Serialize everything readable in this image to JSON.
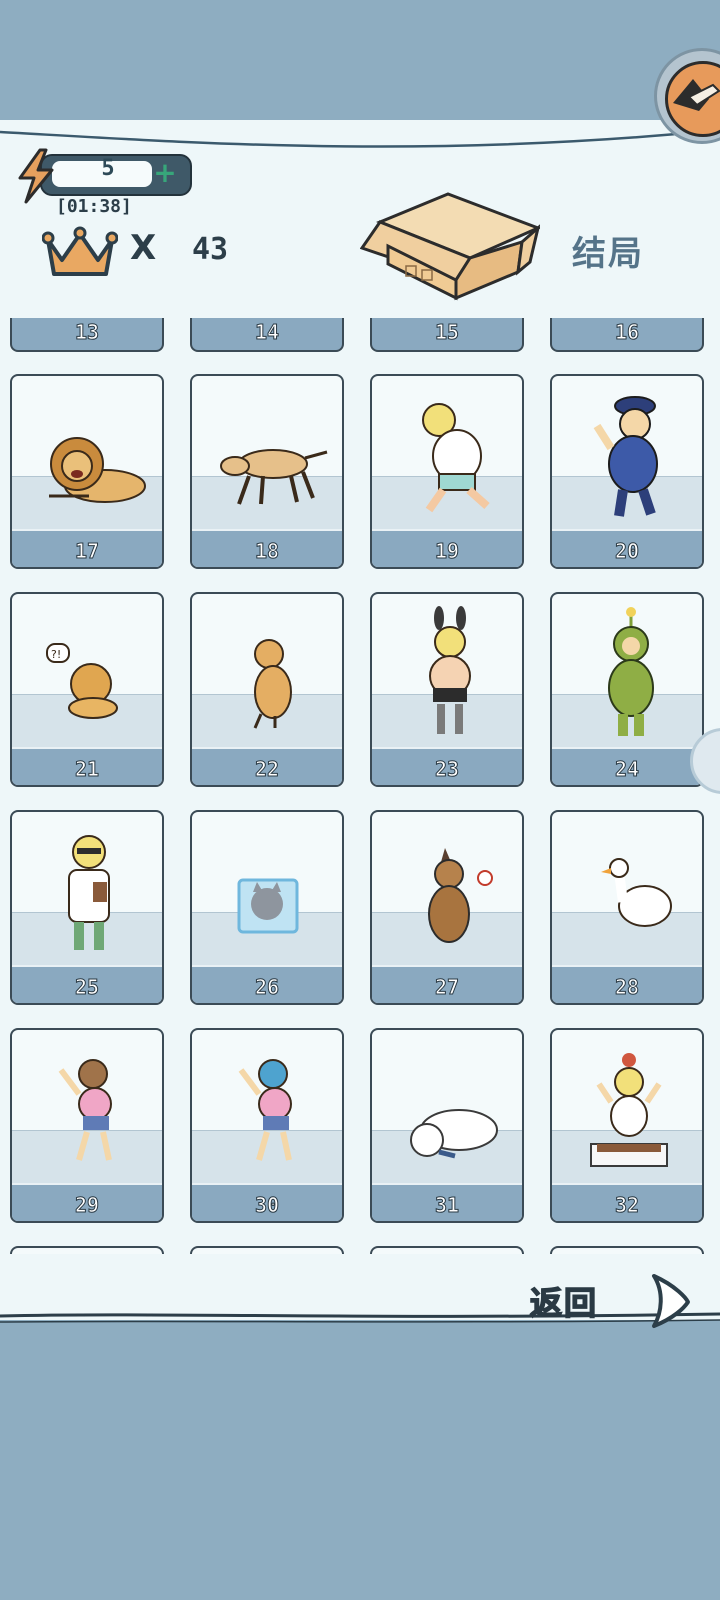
{
  "hud": {
    "energy_count": "5",
    "plus_symbol": "+",
    "timer": "[01:38]",
    "crown_multiplier": "X",
    "crown_count": "43",
    "ending_label": "结局",
    "corner_icon": "compass-badge-icon"
  },
  "grid": {
    "partial_top_numbers": [
      "13",
      "14",
      "15",
      "16"
    ],
    "cards": [
      {
        "number": "17",
        "subject": "lion-icon"
      },
      {
        "number": "18",
        "subject": "dog-sniffing-icon"
      },
      {
        "number": "19",
        "subject": "crying-kid-icon"
      },
      {
        "number": "20",
        "subject": "police-officer-icon"
      },
      {
        "number": "21",
        "subject": "lion-cub-icon"
      },
      {
        "number": "22",
        "subject": "golden-retriever-icon"
      },
      {
        "number": "23",
        "subject": "bunny-costume-kid-icon"
      },
      {
        "number": "24",
        "subject": "green-costume-kid-icon"
      },
      {
        "number": "25",
        "subject": "doctor-icon"
      },
      {
        "number": "26",
        "subject": "frozen-cat-icon"
      },
      {
        "number": "27",
        "subject": "german-shepherd-icon"
      },
      {
        "number": "28",
        "subject": "goose-icon"
      },
      {
        "number": "29",
        "subject": "angry-woman-icon"
      },
      {
        "number": "30",
        "subject": "angry-woman-blue-hair-icon"
      },
      {
        "number": "31",
        "subject": "polar-bear-icon"
      },
      {
        "number": "32",
        "subject": "kid-in-litter-box-icon"
      }
    ]
  },
  "footer": {
    "back_label": "返回"
  },
  "colors": {
    "background": "#8eadc1",
    "panel": "#eef7f9",
    "number_bar": "#8aa9c0",
    "text_dark": "#2c3e49",
    "ending_label": "#557489"
  }
}
